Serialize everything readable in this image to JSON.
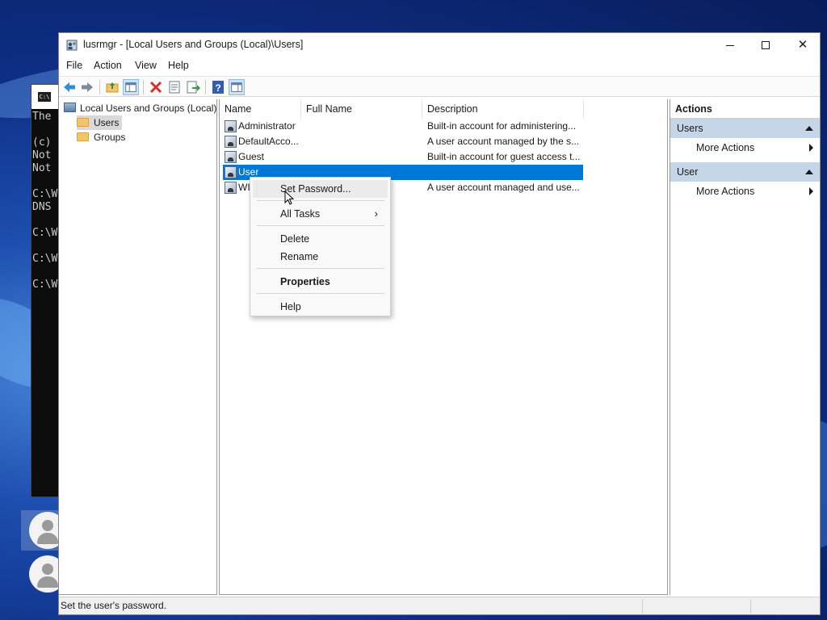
{
  "window": {
    "title": "lusrmgr - [Local Users and Groups (Local)\\Users]",
    "minimize_icon": "minimize-icon",
    "maximize_icon": "maximize-icon",
    "close_glyph": "✕"
  },
  "menu": {
    "file": "File",
    "action": "Action",
    "view": "View",
    "help": "Help"
  },
  "toolbar": {
    "icons": [
      "back-arrow-icon",
      "forward-arrow-icon",
      "up-folder-icon",
      "show-hide-tree-icon",
      "delete-icon",
      "properties-icon",
      "export-list-icon",
      "help-icon",
      "show-hide-action-pane-icon"
    ]
  },
  "tree": {
    "root": "Local Users and Groups (Local)",
    "children": [
      "Users",
      "Groups"
    ],
    "selected": "Users"
  },
  "list": {
    "columns": [
      "Name",
      "Full Name",
      "Description"
    ],
    "rows": [
      {
        "name": "Administrator",
        "full_name": "",
        "description": "Built-in account for administering..."
      },
      {
        "name": "DefaultAcco...",
        "full_name": "",
        "description": "A user account managed by the s..."
      },
      {
        "name": "Guest",
        "full_name": "",
        "description": "Built-in account for guest access t..."
      },
      {
        "name": "User",
        "full_name": "",
        "description": ""
      },
      {
        "name": "WI",
        "full_name": "",
        "description": "A user account managed and use..."
      }
    ],
    "selected_row": "User"
  },
  "actions": {
    "header": "Actions",
    "sections": [
      {
        "title": "Users",
        "items": [
          "More Actions"
        ]
      },
      {
        "title": "User",
        "items": [
          "More Actions"
        ]
      }
    ]
  },
  "context_menu": {
    "set_password": "Set Password...",
    "all_tasks": "All Tasks",
    "all_tasks_chevron": "›",
    "delete": "Delete",
    "rename": "Rename",
    "properties": "Properties",
    "help": "Help"
  },
  "status": {
    "text": "Set the user's password."
  },
  "console": {
    "lines": [
      "The",
      "",
      "(c)",
      "Not",
      "Not",
      "",
      "C:\\W",
      "DNS",
      "",
      "C:\\W",
      "",
      "C:\\W",
      "",
      "C:\\W"
    ],
    "icon_text": "C:\\"
  },
  "colors": {
    "selection": "#0078d7",
    "actions_section": "#c5d6e8",
    "delete_icon": "#d32f2f"
  }
}
